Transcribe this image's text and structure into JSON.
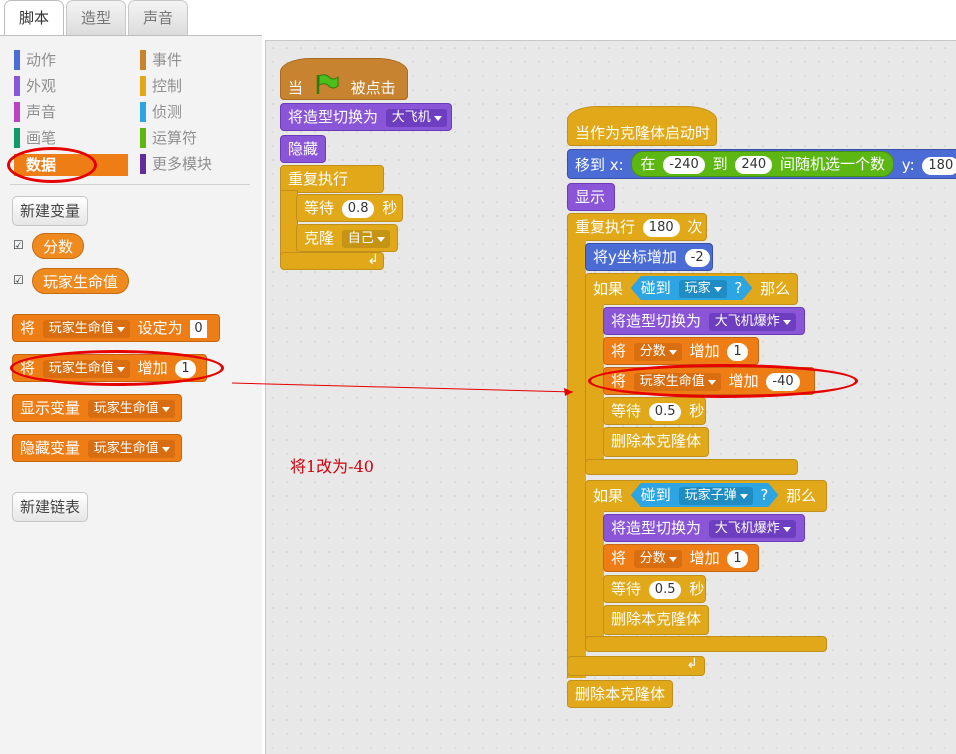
{
  "tabs": [
    "脚本",
    "造型",
    "声音"
  ],
  "categories": [
    {
      "label": "动作",
      "color": "#4a6cd4"
    },
    {
      "label": "外观",
      "color": "#8a55d7"
    },
    {
      "label": "声音",
      "color": "#bb42c3"
    },
    {
      "label": "画笔",
      "color": "#0e9a6c"
    },
    {
      "label": "数据",
      "color": "#ee7d16"
    },
    {
      "label": "事件",
      "color": "#c88330"
    },
    {
      "label": "控制",
      "color": "#e1a91a"
    },
    {
      "label": "侦测",
      "color": "#2ca5e2"
    },
    {
      "label": "运算符",
      "color": "#5cb712"
    },
    {
      "label": "更多模块",
      "color": "#632d99"
    }
  ],
  "palette": {
    "new_variable": "新建变量",
    "var_score": "分数",
    "var_life": "玩家生命值",
    "set_prefix": "将",
    "set_var": "玩家生命值",
    "set_mid": "设定为",
    "set_val": "0",
    "change_prefix": "将",
    "change_var": "玩家生命值",
    "change_mid": "增加",
    "change_val": "1",
    "show_var": "显示变量",
    "show_var_name": "玩家生命值",
    "hide_var": "隐藏变量",
    "hide_var_name": "玩家生命值",
    "new_list": "新建链表"
  },
  "annotation": "将1改为-40",
  "script1": {
    "hat_when": "当",
    "hat_clicked": "被点击",
    "switch_costume": "将造型切换为",
    "costume": "大飞机",
    "hide": "隐藏",
    "forever": "重复执行",
    "wait": "等待",
    "wait_val": "0.8",
    "wait_unit": "秒",
    "clone": "克隆",
    "clone_target": "自己"
  },
  "script2": {
    "hat": "当作为克隆体启动时",
    "goto_prefix": "移到 x:",
    "rand_in": "在",
    "rand_from": "-240",
    "rand_to_word": "到",
    "rand_to": "240",
    "rand_suffix": "间随机选一个数",
    "goto_y": "y:",
    "goto_y_val": "180",
    "show": "显示",
    "repeat": "重复执行",
    "repeat_val": "180",
    "repeat_unit": "次",
    "change_y": "将y坐标增加",
    "change_y_val": "-2",
    "if1": "如果",
    "touching": "碰到",
    "touch1": "玩家",
    "qmark": "?",
    "then": "那么",
    "switch_costume": "将造型切换为",
    "costume_boom": "大飞机爆炸",
    "change_word": "将",
    "var_score": "分数",
    "inc": "增加",
    "score_inc": "1",
    "var_life": "玩家生命值",
    "life_inc": "-40",
    "wait": "等待",
    "wait_val": "0.5",
    "wait_unit": "秒",
    "delete_clone": "删除本克隆体",
    "touch2": "玩家子弹"
  }
}
